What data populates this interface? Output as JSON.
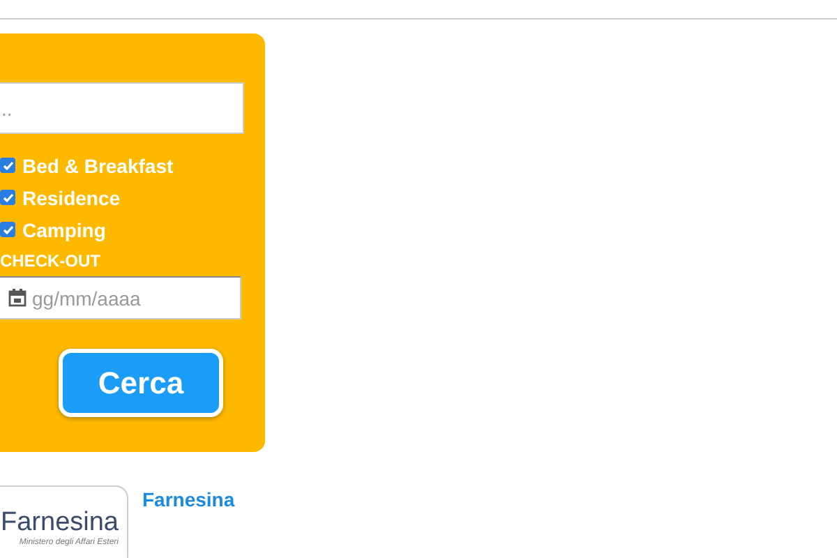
{
  "search_form": {
    "search_field": {
      "placeholder": ".."
    },
    "filters": [
      {
        "label": "Bed & Breakfast",
        "checked": true
      },
      {
        "label": "Residence",
        "checked": true
      },
      {
        "label": "Camping",
        "checked": true
      }
    ],
    "checkout": {
      "label": "CHECK-OUT",
      "placeholder": "gg/mm/aaaa"
    },
    "submit": "Cerca"
  },
  "partner": {
    "logo_title": "Farnesina",
    "logo_subtitle": "Ministero degli Affari Esteri",
    "link": "Farnesina"
  }
}
